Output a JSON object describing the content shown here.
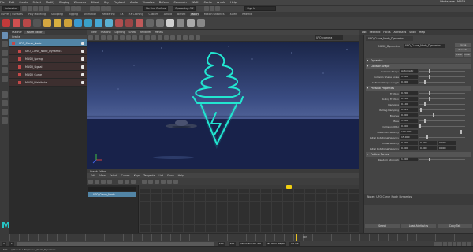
{
  "menubar": {
    "items": [
      "File",
      "Edit",
      "Create",
      "Select",
      "Modify",
      "Display",
      "Windows",
      "Bifrost",
      "Key",
      "Playback",
      "Audio",
      "Visualize",
      "Deform",
      "Constrain",
      "MASH",
      "Cache",
      "Arnold",
      "Help"
    ],
    "workspace": "Workspace : MASH"
  },
  "status": {
    "menu_set": "Animation",
    "live_surface": "No Live Surface",
    "symmetry": "Symmetry: Off",
    "sign_in": "Sign In"
  },
  "shelf_tabs": [
    "Curves / Surfaces",
    "Poly Modeling",
    "Sculpting",
    "Rigging",
    "Animation",
    "Rendering",
    "FX",
    "FX Caching",
    "Custom",
    "Arnold",
    "Bifrost",
    "MASH",
    "Motion Graphics",
    "XGen",
    "Redshift"
  ],
  "shelf_active": "MASH",
  "outliner": {
    "tabs": [
      "Outliner",
      "MASH Editor"
    ],
    "menu": "Create",
    "items": [
      {
        "label": "UFO_Curve_Node",
        "selected": true,
        "child": false
      },
      {
        "label": "UFO_Curve_Node_Dynamics",
        "selected": false,
        "child": true
      },
      {
        "label": "MASH_Spring",
        "selected": false,
        "child": true
      },
      {
        "label": "MASH_Signal",
        "selected": false,
        "child": true
      },
      {
        "label": "MASH_Curve",
        "selected": false,
        "child": true
      },
      {
        "label": "MASH_Distribute",
        "selected": false,
        "child": true
      }
    ]
  },
  "viewport": {
    "menus": [
      "View",
      "Shading",
      "Lighting",
      "Show",
      "Renderer",
      "Panels"
    ],
    "camera": "UFO_camera",
    "neon_color": "#22e6d0"
  },
  "graph_editor": {
    "title": "Graph Editor",
    "menus": [
      "Edit",
      "View",
      "Select",
      "Curves",
      "Keys",
      "Tangents",
      "List",
      "Show",
      "Help"
    ],
    "curve_label": "UFO_Curve_Node"
  },
  "attribute_editor": {
    "tabs": [
      "List",
      "Selected",
      "Focus",
      "Attributes",
      "Show",
      "Help"
    ],
    "node_tab": "UFO_Curve_Node_Dynamics",
    "type_label": "MASH_Dynamics:",
    "type_value": "UFO_Curve_Node_Dynamics",
    "type_buttons": [
      "Focus",
      "Presets",
      "Show",
      "Hide"
    ],
    "header_label": "Dynamics",
    "sections": [
      {
        "title": "Collision Shape",
        "attrs": [
          {
            "label": "Collision Shape",
            "value": "Automatic"
          },
          {
            "label": "Collision Shape Scale",
            "value": "1.000"
          },
          {
            "label": "Collision Shape Length",
            "value": "0.000"
          }
        ]
      },
      {
        "title": "Physical Properties",
        "attrs": [
          {
            "label": "Friction",
            "value": "0.200"
          },
          {
            "label": "Rolling Friction",
            "value": "0.200"
          },
          {
            "label": "Damping",
            "value": "0.100"
          },
          {
            "label": "Rolling Damping",
            "value": "0.010"
          },
          {
            "label": "Bounce",
            "value": "0.300"
          },
          {
            "label": "Mass",
            "value": "1.000"
          },
          {
            "label": "Collision Jitter",
            "value": "0.000"
          },
          {
            "label": "Maximum Velocity",
            "value": "100.000"
          },
          {
            "label": "Initial Rotational Velocity",
            "value": "15.000"
          },
          {
            "label": "Initial Velocity",
            "value": "0.000",
            "v2": "0.000",
            "v3": "0.000"
          },
          {
            "label": "Initial Rotational Velocity",
            "value": "0.000",
            "v2": "0.000",
            "v3": "0.000"
          }
        ]
      },
      {
        "title": "Particle Forces",
        "attrs": [
          {
            "label": "Random Strength",
            "value": "1.000"
          }
        ]
      }
    ],
    "notes": "Notes: UFO_Curve_Node_Dynamics",
    "buttons": [
      "Select",
      "Load Attributes",
      "Copy Tab"
    ]
  },
  "timeline": {
    "current_frame": "103",
    "range_start": "1",
    "range_end": "200",
    "anim_start": "1",
    "anim_end": "200",
    "character_set": "No Character Set",
    "anim_layer": "No Anim Layer",
    "fps": "24 fps"
  },
  "cmd": {
    "lang": "MEL",
    "result": "// Result: UFO_Curve_Node_Dynamics"
  }
}
